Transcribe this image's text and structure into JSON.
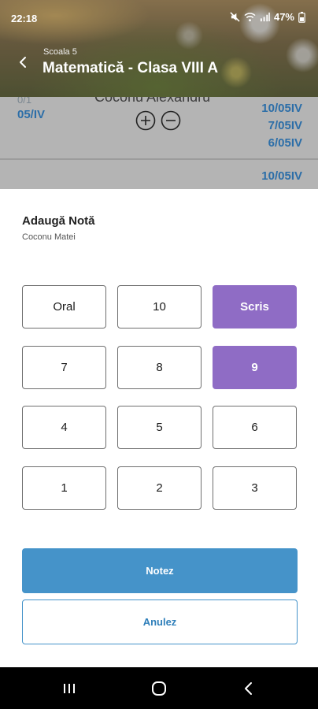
{
  "status_bar": {
    "time": "22:18",
    "battery": "47%",
    "icons": [
      "mute-icon",
      "wifi-icon",
      "signal-icon",
      "battery-icon"
    ]
  },
  "header": {
    "subtitle": "Scoala 5",
    "title": "Matematică - Clasa VIII A",
    "back_icon": "back-arrow-icon"
  },
  "background_list": {
    "count_label": "0/1",
    "left_date": "05/IV",
    "student_name": "Coconu Alexandru",
    "dates": [
      "10/05IV",
      "7/05IV",
      "6/05IV"
    ],
    "next_row_date": "10/05IV",
    "plus_icon": "plus-circle-icon",
    "minus_icon": "minus-circle-icon"
  },
  "sheet": {
    "title": "Adaugă Notă",
    "student": "Coconu Matei",
    "keys": [
      {
        "label": "Oral",
        "selected": false
      },
      {
        "label": "10",
        "selected": false
      },
      {
        "label": "Scris",
        "selected": true
      },
      {
        "label": "7",
        "selected": false
      },
      {
        "label": "8",
        "selected": false
      },
      {
        "label": "9",
        "selected": true
      },
      {
        "label": "4",
        "selected": false
      },
      {
        "label": "5",
        "selected": false
      },
      {
        "label": "6",
        "selected": false
      },
      {
        "label": "1",
        "selected": false
      },
      {
        "label": "2",
        "selected": false
      },
      {
        "label": "3",
        "selected": false
      }
    ],
    "confirm_label": "Notez",
    "cancel_label": "Anulez"
  },
  "nav_bar": {
    "recents_icon": "recents-icon",
    "home_icon": "home-icon",
    "back_icon": "nav-back-icon"
  },
  "colors": {
    "accent_selected": "#8f6cc5",
    "primary_button": "#4593c9",
    "link_blue": "#2c6ea8"
  }
}
